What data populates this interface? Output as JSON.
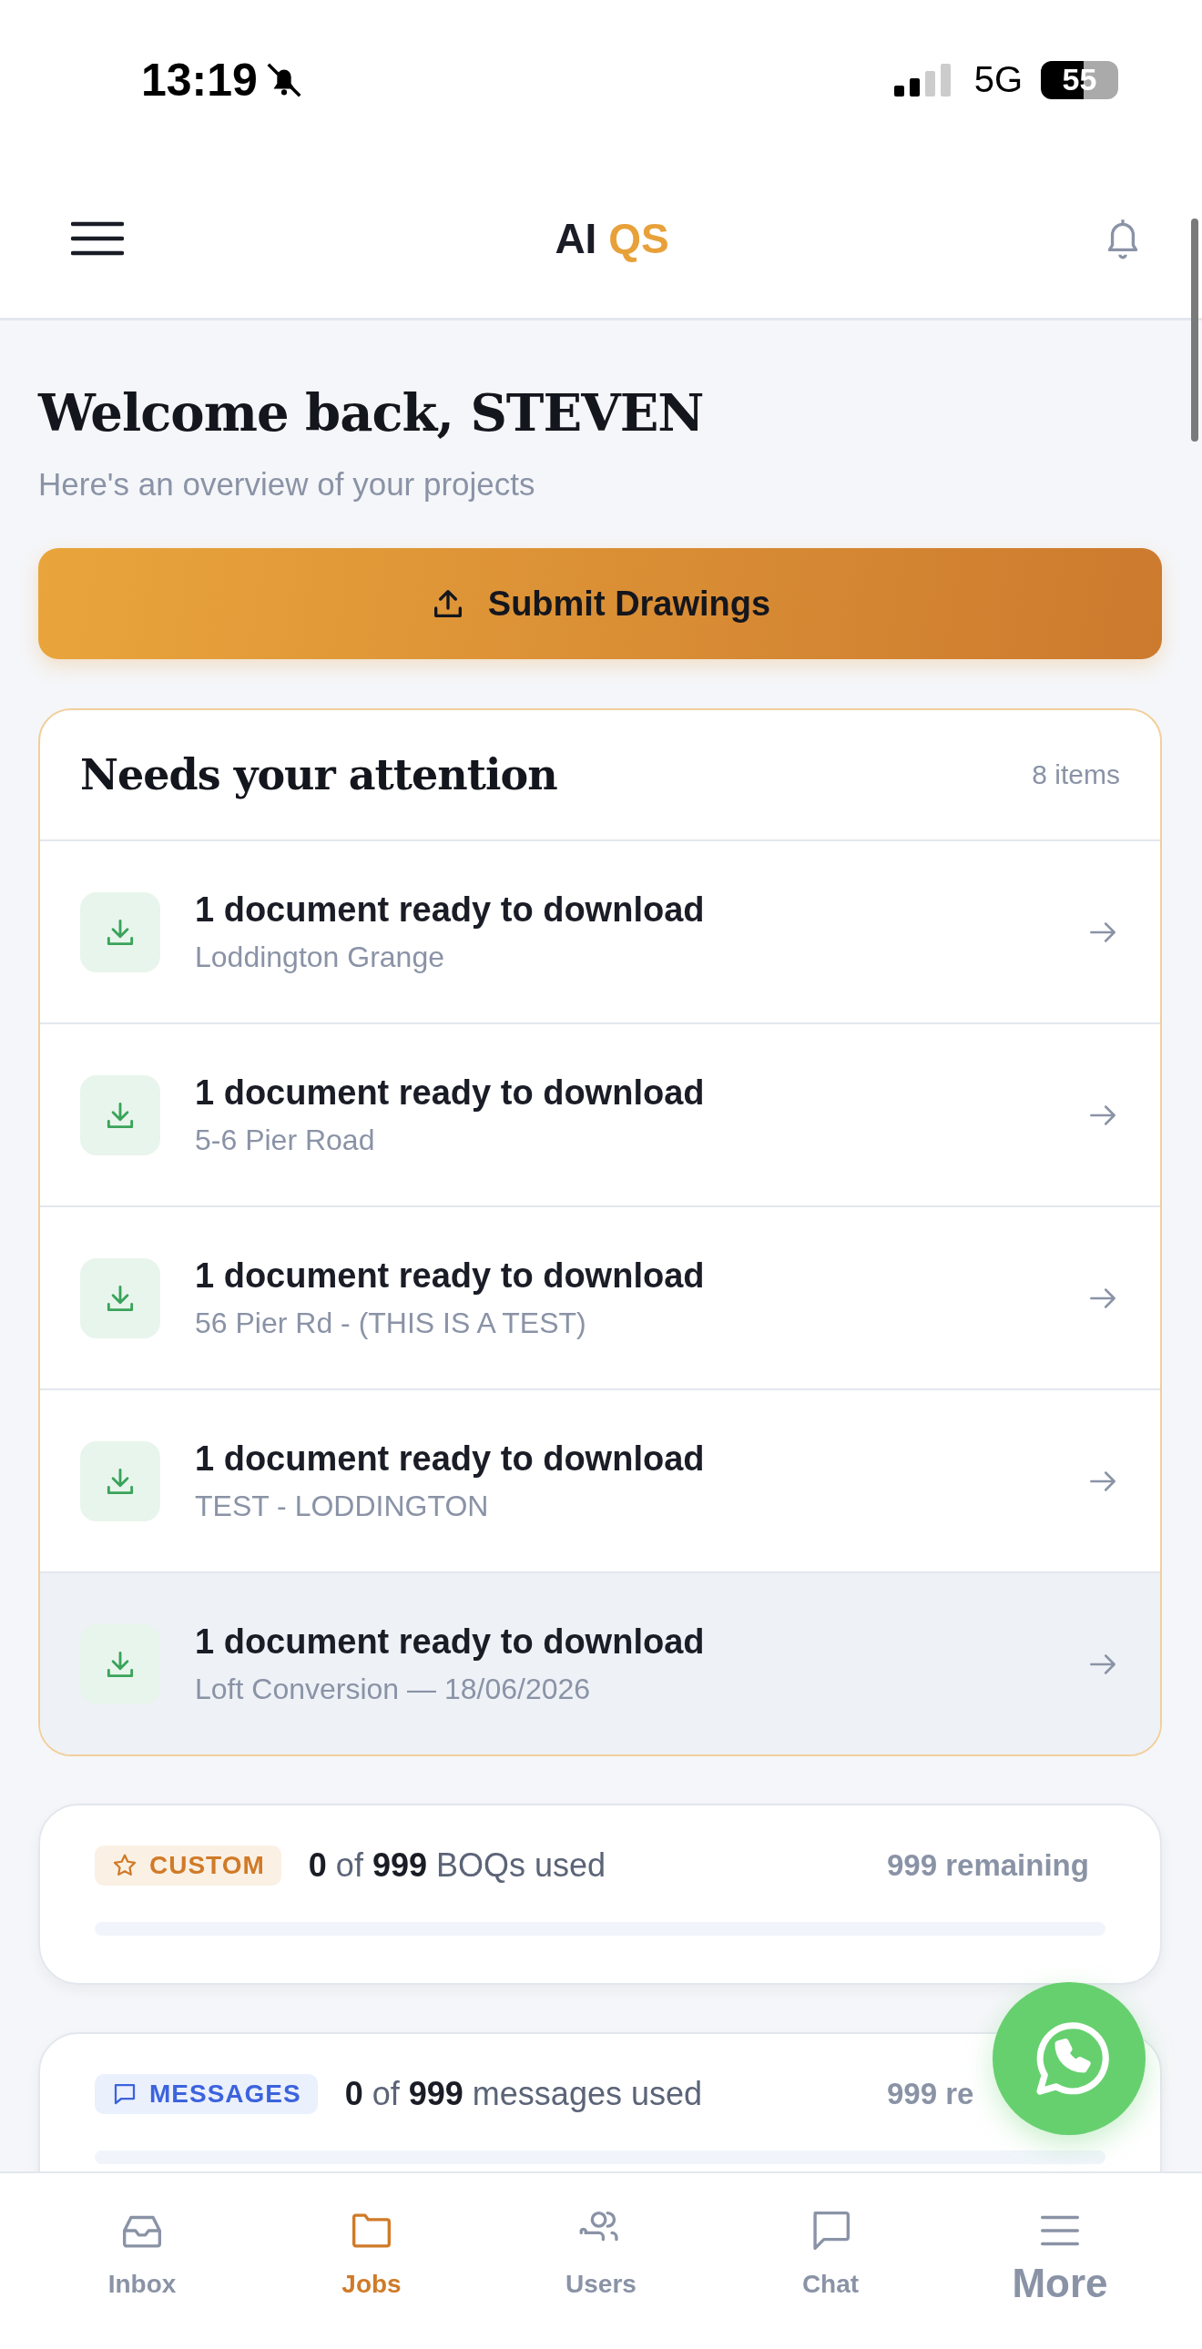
{
  "status_bar": {
    "time": "13:19",
    "network": "5G",
    "battery": "55"
  },
  "header": {
    "logo": "AI",
    "logo_accent": "QS"
  },
  "welcome": {
    "title": "Welcome back, STEVEN",
    "subtitle": "Here's an overview of your projects"
  },
  "submit_button": {
    "label": "Submit Drawings"
  },
  "attention": {
    "title": "Needs your attention",
    "count": "8 items",
    "items": [
      {
        "title": "1 document ready to download",
        "project": "Loddington Grange",
        "selected": false
      },
      {
        "title": "1 document ready to download",
        "project": "5-6 Pier Road",
        "selected": false
      },
      {
        "title": "1 document ready to download",
        "project": "56 Pier Rd - (THIS IS A TEST)",
        "selected": false
      },
      {
        "title": "1 document ready to download",
        "project": "TEST - LODDINGTON",
        "selected": false
      },
      {
        "title": "1 document ready to download",
        "project": "Loft Conversion — 18/06/2026",
        "selected": true
      }
    ]
  },
  "usage": [
    {
      "kind": "custom",
      "badge": "CUSTOM",
      "text": "**0** of **999** BOQs used",
      "remaining": "999 remaining",
      "level": 0
    },
    {
      "kind": "messages",
      "badge": "MESSAGES",
      "text": "**0** of **999** messages used",
      "remaining": "999 re",
      "level": 0
    }
  ],
  "bottom_nav": [
    {
      "kind": "inbox",
      "label": "Inbox",
      "selected": false
    },
    {
      "kind": "jobs",
      "label": "Jobs",
      "selected": true
    },
    {
      "kind": "users",
      "label": "Users",
      "selected": false
    },
    {
      "kind": "chat",
      "label": "Chat",
      "selected": false
    },
    {
      "kind": "more",
      "label": "More",
      "selected": false
    }
  ]
}
